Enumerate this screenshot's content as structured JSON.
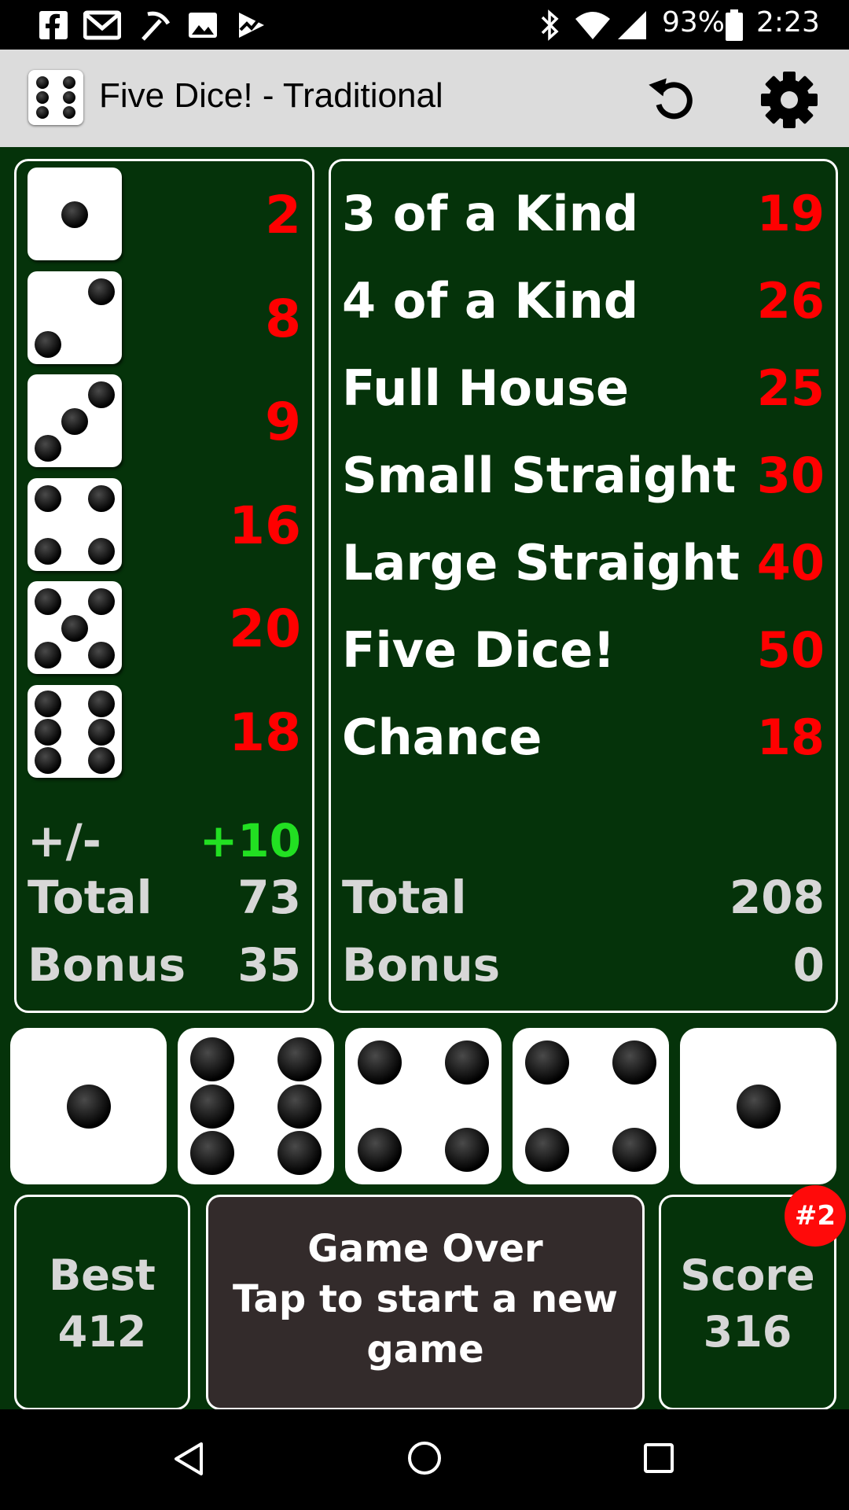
{
  "status_bar": {
    "battery": "93%",
    "time": "2:23",
    "left_icons": [
      "facebook-icon",
      "gmail-icon",
      "pickaxe-icon",
      "image-icon",
      "activity-icon"
    ],
    "right_icons": [
      "bluetooth-icon",
      "wifi-icon",
      "signal-icon",
      "battery-icon"
    ]
  },
  "app_bar": {
    "title": "Five Dice! - Traditional",
    "icons": [
      "dice-app-icon",
      "undo-icon",
      "gear-icon"
    ]
  },
  "upper_section": {
    "rows": [
      {
        "die": 1,
        "score": "2"
      },
      {
        "die": 2,
        "score": "8"
      },
      {
        "die": 3,
        "score": "9"
      },
      {
        "die": 4,
        "score": "16"
      },
      {
        "die": 5,
        "score": "20"
      },
      {
        "die": 6,
        "score": "18"
      }
    ],
    "plus_minus_label": "+/-",
    "plus_minus_value": "+10",
    "total_label": "Total",
    "total_value": "73",
    "bonus_label": "Bonus",
    "bonus_value": "35"
  },
  "lower_section": {
    "rows": [
      {
        "label": "3 of a Kind",
        "score": "19"
      },
      {
        "label": "4 of a Kind",
        "score": "26"
      },
      {
        "label": "Full House",
        "score": "25"
      },
      {
        "label": "Small Straight",
        "score": "30"
      },
      {
        "label": "Large Straight",
        "score": "40"
      },
      {
        "label": "Five Dice!",
        "score": "50"
      },
      {
        "label": "Chance",
        "score": "18"
      }
    ],
    "total_label": "Total",
    "total_value": "208",
    "bonus_label": "Bonus",
    "bonus_value": "0"
  },
  "rolled_dice": [
    1,
    6,
    4,
    4,
    1
  ],
  "best": {
    "label": "Best",
    "value": "412"
  },
  "game_over": {
    "line1": "Game Over",
    "line2": "Tap to start a new",
    "line3": "game"
  },
  "score": {
    "label": "Score",
    "value": "316",
    "rank": "#2"
  },
  "colors": {
    "table_green": "#05330a",
    "score_red": "#ff0000",
    "plus_minus_green": "#22e022",
    "summary_gray": "#d7d7d7",
    "game_over_bg": "#332b2b",
    "rank_badge": "#ff0a0a"
  },
  "nav_bar": {
    "icons": [
      "back-icon",
      "home-icon",
      "recents-icon"
    ]
  }
}
